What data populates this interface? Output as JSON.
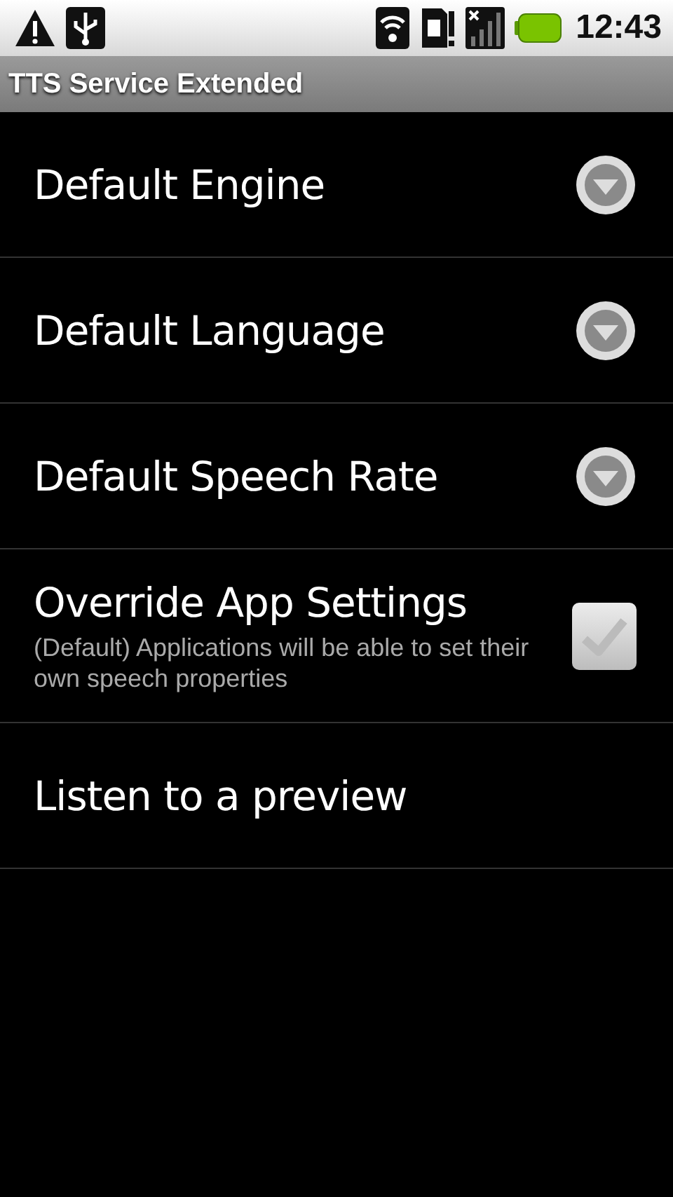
{
  "status_bar": {
    "time": "12:43"
  },
  "title": "TTS Service Extended",
  "items": [
    {
      "kind": "list",
      "title": "Default Engine"
    },
    {
      "kind": "list",
      "title": "Default Language"
    },
    {
      "kind": "list",
      "title": "Default Speech Rate"
    },
    {
      "kind": "checkbox",
      "title": "Override App Settings",
      "summary": "(Default) Applications will be able to set their own speech properties",
      "checked": true,
      "disabled": true
    },
    {
      "kind": "plain",
      "title": "Listen to a preview"
    }
  ]
}
